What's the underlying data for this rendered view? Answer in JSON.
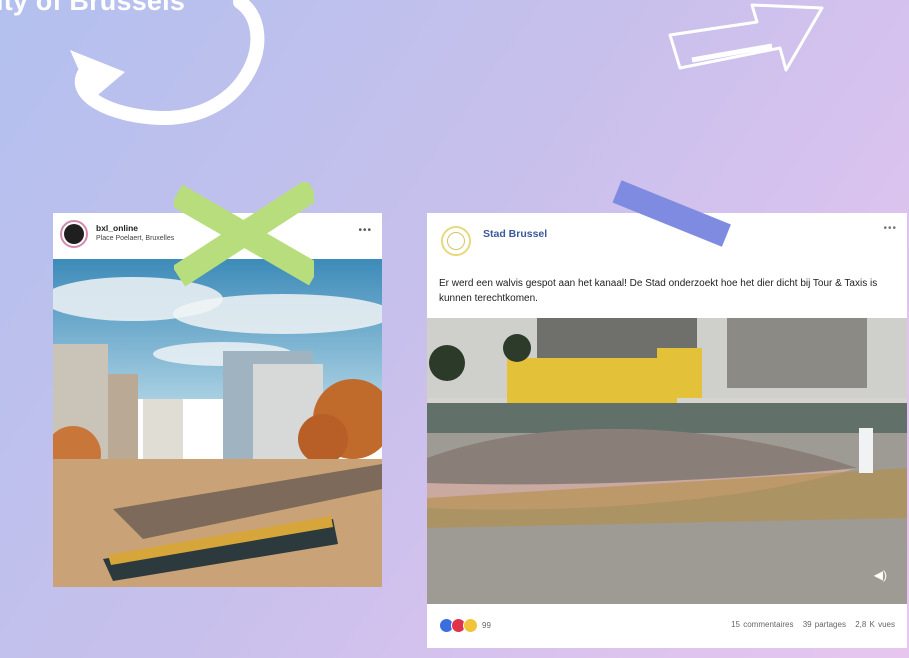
{
  "header": {
    "title": "ity of Brussels"
  },
  "instagram": {
    "username": "bxl_online",
    "location": "Place Poelaert, Bruxelles",
    "more": "•••"
  },
  "facebook": {
    "page_name": "Stad Brussel",
    "more": "•••",
    "post_text": "Er werd een walvis gespot aan het kanaal! De Stad onderzoekt hoe het dier dicht bij Tour & Taxis is kunnen terechtkomen.",
    "reactions_count": "99",
    "comments": "15 commentaires",
    "shares": "39 partages",
    "views": "2,8 K vues",
    "volume_icon": "volume-icon"
  },
  "colors": {
    "facebook_blue": "#3b5998",
    "tape_green": "#b8dd7c",
    "tape_blue": "#7f8be0"
  }
}
